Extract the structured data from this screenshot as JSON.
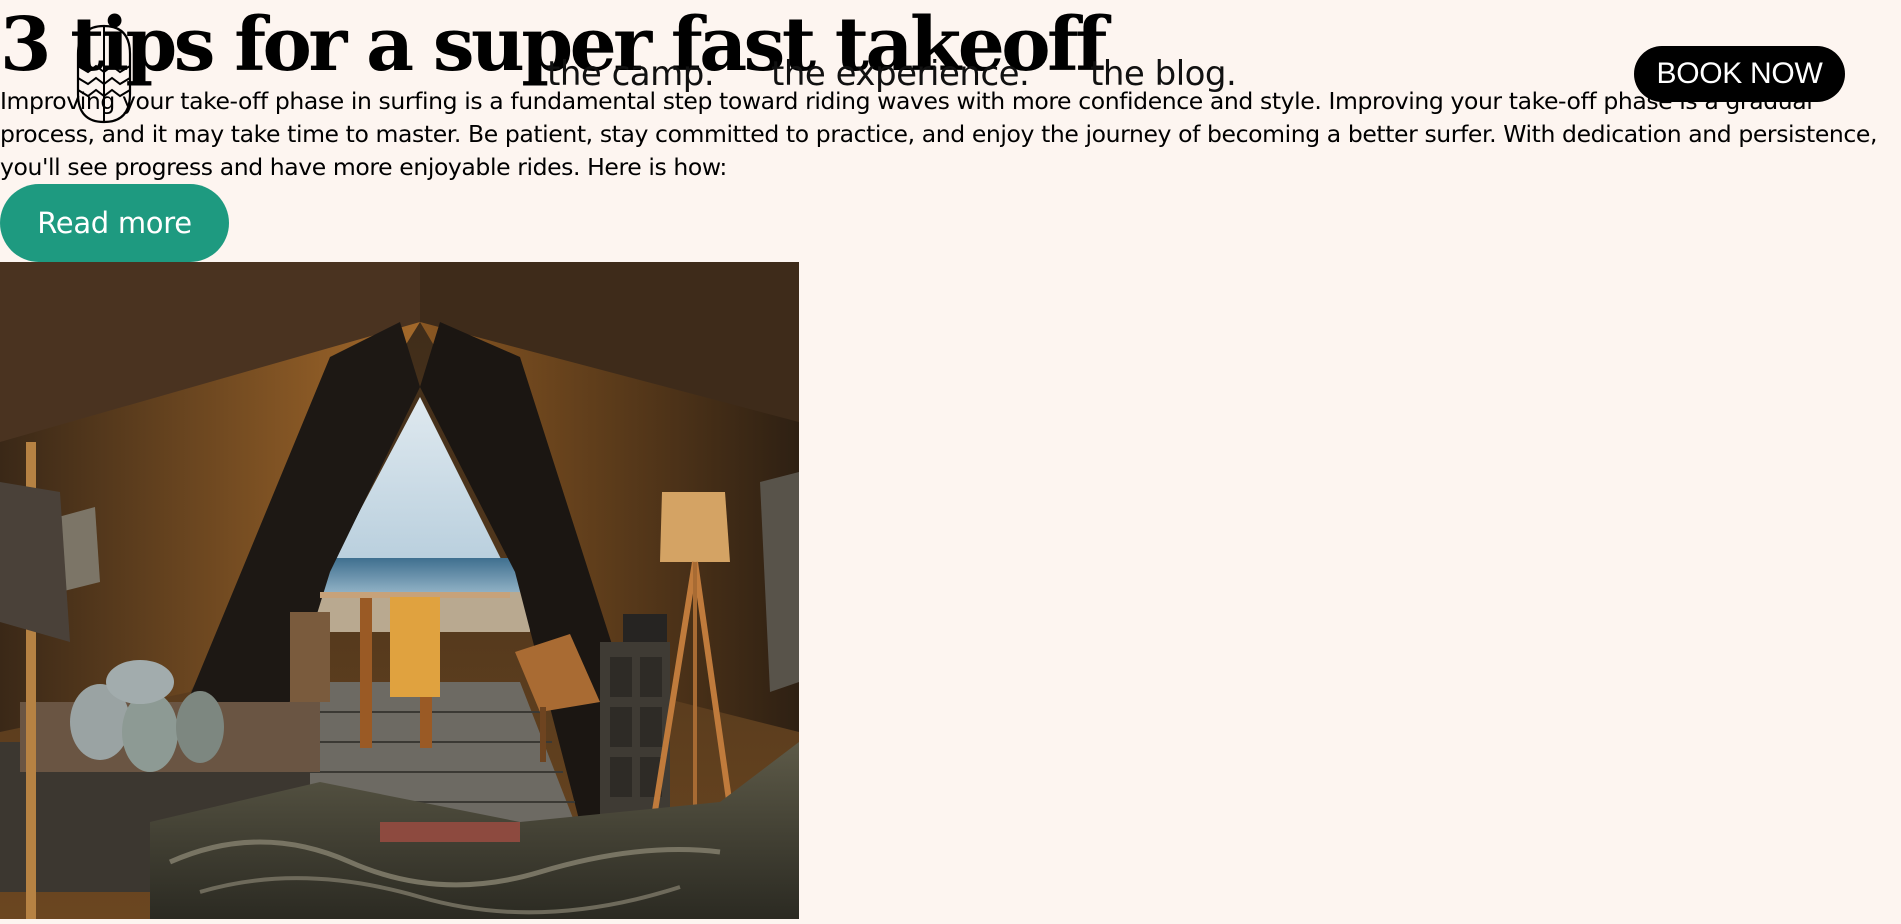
{
  "header": {
    "logo_icon": "surf-camp-logo-icon",
    "nav": [
      {
        "label": "the camp."
      },
      {
        "label": "the experience."
      },
      {
        "label": "the blog."
      }
    ],
    "book_now_label": "BOOK NOW"
  },
  "post": {
    "title": "3 tips for a super fast takeoff",
    "excerpt": "Improving your take-off phase in surfing is a fundamental step toward riding waves with more confidence and style. Improving your take-off phase is a gradual process, and it may take time to master. Be patient, stay committed to practice, and enjoy the journey of becoming a better surfer. With dedication and persistence, you'll see progress and have more enjoyable rides. Here is how:",
    "read_more_label": "Read more",
    "image_subject": "glamping tent interior opening onto ocean deck"
  },
  "colors": {
    "background": "#fdf5f0",
    "accent": "#1e9a80",
    "book_button": "#000000",
    "text": "#000000"
  }
}
